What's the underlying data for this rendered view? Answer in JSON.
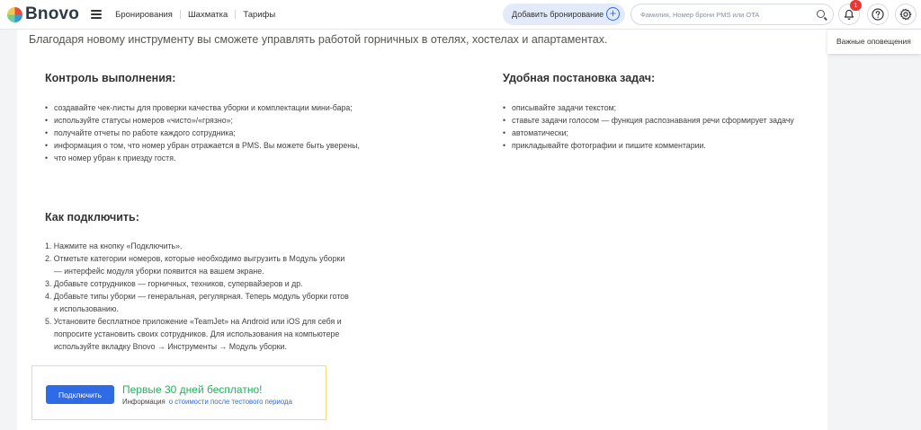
{
  "header": {
    "logo_text": "Bnovo",
    "nav": [
      "Бронирования",
      "Шахматка",
      "Тарифы"
    ],
    "add_booking_label": "Добавить бронирование",
    "search_placeholder": "Фамилия, Номер брони PMS или OTA",
    "notification_count": "1",
    "icons": [
      "menu-icon",
      "plus-circle-icon",
      "search-icon",
      "bell-icon",
      "help-icon",
      "gear-icon"
    ],
    "accent_color": "#2f6be6"
  },
  "alerts_popup": {
    "label": "Важные оповещения"
  },
  "main": {
    "intro": "Благодаря новому инструменту вы сможете управлять работой горничных в отелях, хостелах и апартаментах.",
    "control": {
      "title": "Контроль выполнения:",
      "items": [
        "создавайте чек-листы для проверки качества уборки и комплектации мини-бара;",
        "используйте статусы номеров «чисто»/«грязно»;",
        "получайте отчеты по работе каждого сотрудника;",
        "информация о том, что номер убран отражается в PMS. Вы можете быть уверены,",
        "что номер убран к приезду гостя."
      ]
    },
    "tasks": {
      "title": "Удобная постановка задач:",
      "items": [
        "описывайте задачи текстом;",
        "ставьте задачи голосом — функция распознавания речи сформирует задачу",
        "автоматически;",
        "прикладывайте фотографии и пишите комментарии."
      ]
    },
    "howto": {
      "title": "Как подключить:",
      "steps": [
        "1. Нажмите на кнопку «Подключить».",
        "2. Отметьте категории номеров, которые необходимо выгрузить в Модуль уборки",
        "— интерфейс модуля уборки появится на вашем экране.",
        "3. Добавьте сотрудников — горничных, техников, супервайзеров и др.",
        "4. Добавьте типы уборки — генеральная, регулярная. Теперь модуль уборки готов",
        "к использованию.",
        "5. Установите бесплатное приложение «TeamJet» на Android или iOS для себя и",
        "попросите установить своих сотрудников. Для использования на компьютере",
        "используйте вкладку Bnovo → Инструменты → Модуль уборки."
      ]
    },
    "connect": {
      "button_label": "Подключить",
      "free_text": "Первые 30 дней бесплатно!",
      "info_label": "Информация",
      "info_link": "о стоимости после тестового периода",
      "highlight_color": "#f4dc7b",
      "free_color": "#27ae60"
    }
  }
}
